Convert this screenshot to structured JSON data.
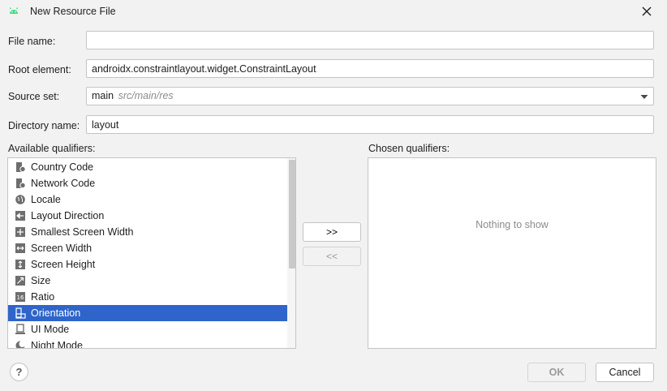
{
  "window": {
    "title": "New Resource File",
    "app_icon": "android-icon",
    "close_icon": "close-icon"
  },
  "form": {
    "file_name": {
      "label": "File name:",
      "value": ""
    },
    "root_element": {
      "label": "Root element:",
      "value": "androidx.constraintlayout.widget.ConstraintLayout"
    },
    "source_set": {
      "label": "Source set:",
      "value": "main",
      "hint": "src/main/res"
    },
    "directory_name": {
      "label": "Directory name:",
      "value": "layout"
    }
  },
  "available": {
    "label": "Available qualifiers:",
    "items": [
      {
        "label": "Country Code",
        "icon": "country-code-icon"
      },
      {
        "label": "Network Code",
        "icon": "network-code-icon"
      },
      {
        "label": "Locale",
        "icon": "globe-icon"
      },
      {
        "label": "Layout Direction",
        "icon": "layout-direction-icon"
      },
      {
        "label": "Smallest Screen Width",
        "icon": "smallest-width-icon"
      },
      {
        "label": "Screen Width",
        "icon": "screen-width-icon"
      },
      {
        "label": "Screen Height",
        "icon": "screen-height-icon"
      },
      {
        "label": "Size",
        "icon": "size-icon"
      },
      {
        "label": "Ratio",
        "icon": "ratio-icon"
      },
      {
        "label": "Orientation",
        "icon": "orientation-icon",
        "selected": true
      },
      {
        "label": "UI Mode",
        "icon": "ui-mode-icon"
      },
      {
        "label": "Night Mode",
        "icon": "night-mode-icon"
      }
    ]
  },
  "transfer": {
    "add_label": ">>",
    "remove_label": "<<"
  },
  "chosen": {
    "label": "Chosen qualifiers:",
    "empty_text": "Nothing to show"
  },
  "footer": {
    "help_label": "?",
    "ok_label": "OK",
    "cancel_label": "Cancel"
  },
  "colors": {
    "selection": "#2f65ca",
    "android_green": "#3ddc84",
    "icon_gray": "#6e6e6e"
  }
}
